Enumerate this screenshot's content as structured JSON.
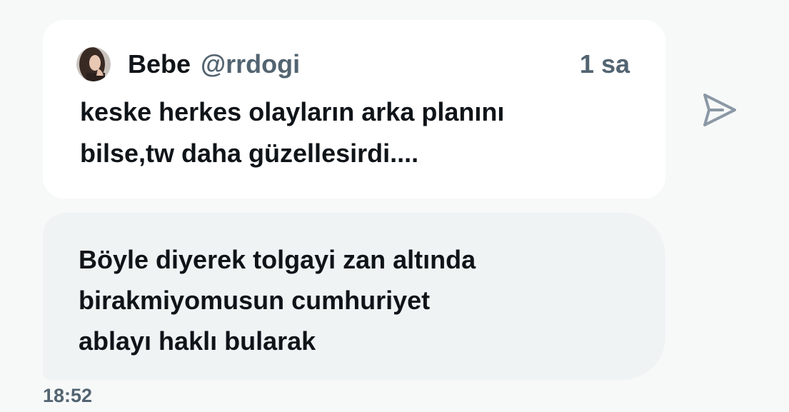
{
  "quoted_tweet": {
    "author_name": "Bebe",
    "author_handle": "@rrdogi",
    "time_ago": "1 sa",
    "text": "keske herkes olayların arka planını\nbilse,tw daha güzellesirdi....",
    "avatar_icon": "user-avatar"
  },
  "share": {
    "icon": "send-icon"
  },
  "message": {
    "text": "Böyle diyerek tolgayi zan altında\nbirakmiyomusun cumhuriyet\nablayı haklı bularak",
    "time": "18:52"
  },
  "colors": {
    "background": "#f7f9f9",
    "card": "#ffffff",
    "bubble": "#eff3f4",
    "primary_text": "#0f1419",
    "secondary_text": "#536471",
    "icon": "#8b98a5"
  }
}
